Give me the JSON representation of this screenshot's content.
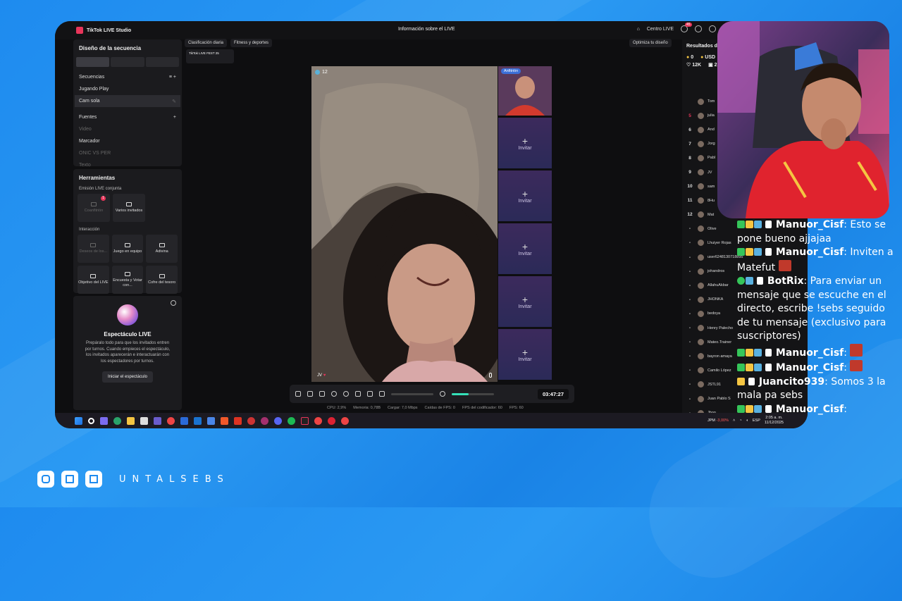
{
  "app": {
    "title": "TikTok LIVE Studio",
    "center_title": "Información sobre el LIVE",
    "centro_live": "Centro LIVE",
    "notif_count": "45"
  },
  "left": {
    "design_title": "Diseño de la secuencia",
    "sequences_title": "Secuencias",
    "sequences": [
      "Jugando Play",
      "Cam sola"
    ],
    "sources_title": "Fuentes",
    "sources": [
      "Video",
      "Marcador",
      "ONIC VS PER",
      "Texto"
    ],
    "tools_title": "Herramientas",
    "joint_label": "Emisión LIVE conjunta",
    "joint_tools": [
      {
        "label": "Coanfitrión",
        "badge": "1"
      },
      {
        "label": "Varios invitados"
      }
    ],
    "interaction_label": "Interacción",
    "interaction_tools": [
      "Deseos de los...",
      "Juego en equipo",
      "Adivina",
      "Objetivo del LIVE",
      "Encuesta y Votar con...",
      "Cofre del tesoro"
    ],
    "show_title": "Espectáculo LIVE",
    "show_desc": "Prepáralo todo para que los invitados entren por turnos. Cuando empieces el espectáculo, los invitados aparecerán e interactuarán con los espectadores por turnos.",
    "show_button": "Iniciar el espectáculo"
  },
  "top": {
    "chips": [
      "Clasificación diaria",
      "Fitness y deportes"
    ],
    "fest": "TikTok LIVE FEST 25",
    "optimize": "Optimiza tu diseño"
  },
  "preview": {
    "viewers": "12",
    "host_label": "Anfitrión",
    "guest_tag": "JV",
    "invite_label": "Invitar"
  },
  "controls": {
    "timer": "03:47:27",
    "volume_fraction": 0.4
  },
  "stats": [
    "CPU: 2,9%",
    "Memoria: 0,78B",
    "Cargar: 7,0 Mbps",
    "Caídas de FPS: 0",
    "FPS del codificador: 60",
    "FPS: 60"
  ],
  "right": {
    "title": "Resultados de",
    "coins": "0",
    "usd": "USD",
    "likes": "12K",
    "gifts": "2",
    "ranking": [
      {
        "n": "",
        "name": "Tom"
      },
      {
        "n": "5",
        "name": "julia"
      },
      {
        "n": "6",
        "name": "And"
      },
      {
        "n": "7",
        "name": "Jorg"
      },
      {
        "n": "8",
        "name": "Pabl"
      },
      {
        "n": "9",
        "name": "JV"
      },
      {
        "n": "10",
        "name": "sam"
      },
      {
        "n": "11",
        "name": "8Hu"
      },
      {
        "n": "12",
        "name": "Mat"
      },
      {
        "n": "-",
        "name": "Olive"
      },
      {
        "n": "-",
        "name": "Lhuiyer Rojas"
      },
      {
        "n": "-",
        "name": "user6248130718895"
      },
      {
        "n": "-",
        "name": "johandros"
      },
      {
        "n": "-",
        "name": "AllahuAkbar"
      },
      {
        "n": "-",
        "name": "JHONKA"
      },
      {
        "n": "-",
        "name": "bedoya"
      },
      {
        "n": "-",
        "name": "Henry Palecho"
      },
      {
        "n": "-",
        "name": "Mateo.Trainer"
      },
      {
        "n": "-",
        "name": "bayron amaya"
      },
      {
        "n": "-",
        "name": "Camilo López"
      },
      {
        "n": "-",
        "name": "JSTL91"
      },
      {
        "n": "-",
        "name": "Juan Pablo S"
      },
      {
        "n": "-",
        "name": "Jhon"
      },
      {
        "n": "-",
        "name": "Miguel D."
      }
    ]
  },
  "tray": {
    "ticker": "JPM",
    "change": "-3,00%",
    "lang": "ESP",
    "time": "2:05 a. m.",
    "date": "11/12/2025"
  },
  "chat": [
    {
      "user": "Manuor_Cisf",
      "text": ": Esto se pone bueno ajjajaa"
    },
    {
      "user": "Manuor_Cisf",
      "text": ": Inviten a Matefut"
    },
    {
      "user": "BotRix",
      "text": ": Para enviar un mensaje que se escuche en el directo, escribe !sebs seguido de tu mensaje (exclusivo para suscriptores)"
    },
    {
      "user": "Manuor_Cisf",
      "text": ":"
    },
    {
      "user": "Manuor_Cisf",
      "text": ":"
    },
    {
      "user": "Juancito939",
      "text": ": Somos 3 la mala pa sebs"
    },
    {
      "user": "Manuor_Cisf",
      "text": ":"
    }
  ],
  "brand": "UNTALSEBS",
  "colors": {
    "background": "#1e8bef",
    "accent": "#e8355a",
    "invite_tile": "#3c2a5c"
  }
}
